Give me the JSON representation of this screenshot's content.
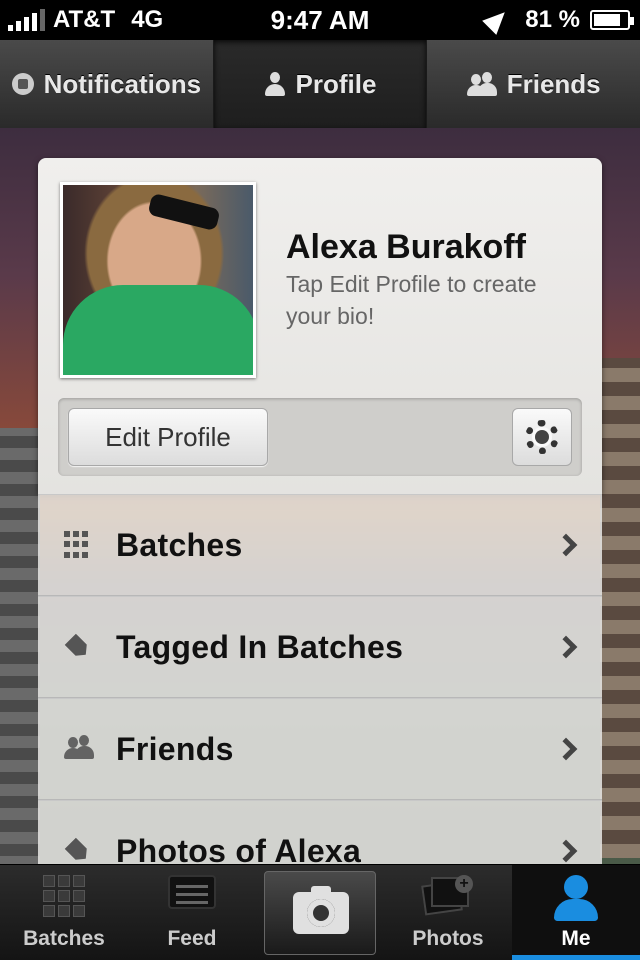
{
  "status_bar": {
    "carrier": "AT&T",
    "network": "4G",
    "time": "9:47 AM",
    "battery": "81 %",
    "battery_level": 0.81
  },
  "top_tabs": [
    {
      "label": "Notifications",
      "icon": "notifications-icon",
      "active": false
    },
    {
      "label": "Profile",
      "icon": "person-icon",
      "active": true
    },
    {
      "label": "Friends",
      "icon": "friends-icon",
      "active": false
    }
  ],
  "profile": {
    "name": "Alexa Burakoff",
    "bio_prompt": "Tap Edit Profile to create your bio!",
    "edit_button": "Edit Profile",
    "settings_icon": "gear-icon"
  },
  "menu": [
    {
      "label": "Batches",
      "icon": "grid-icon"
    },
    {
      "label": "Tagged In Batches",
      "icon": "tag-icon"
    },
    {
      "label": "Friends",
      "icon": "friends-icon"
    },
    {
      "label": "Photos of Alexa",
      "icon": "tag-icon"
    }
  ],
  "tab_bar": [
    {
      "label": "Batches",
      "icon": "grid-icon",
      "active": false
    },
    {
      "label": "Feed",
      "icon": "feed-icon",
      "active": false
    },
    {
      "label": "",
      "icon": "camera-icon",
      "active": false
    },
    {
      "label": "Photos",
      "icon": "photos-icon",
      "active": false
    },
    {
      "label": "Me",
      "icon": "person-icon",
      "active": true
    }
  ],
  "colors": {
    "accent": "#1a8de0",
    "tab_bar_bg": "#141414",
    "card_bg": "#f0efed"
  }
}
